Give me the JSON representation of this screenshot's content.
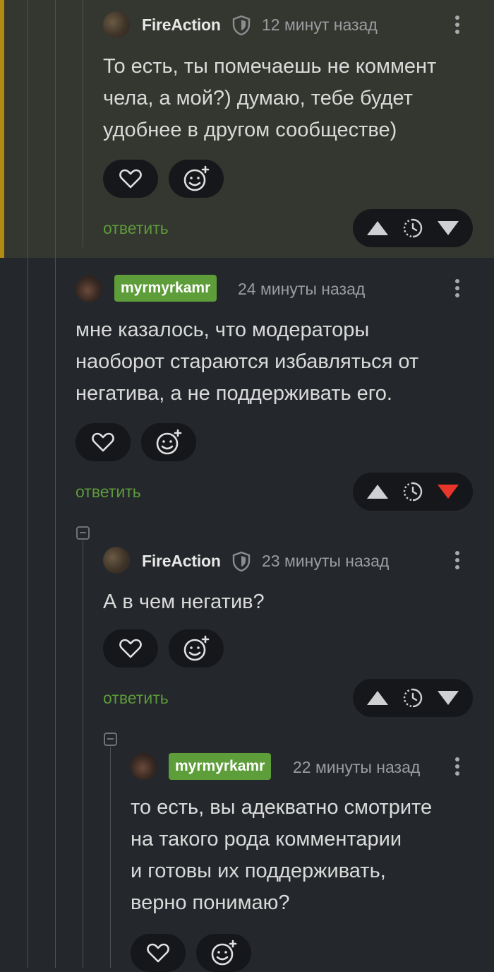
{
  "colors": {
    "accent_green": "#5e9e3a",
    "downvote_red": "#e8362a",
    "highlight_bar": "#b08a12"
  },
  "comments": [
    {
      "author": "FireAction",
      "time": "12 минут назад",
      "lines": [
        "То есть, ты помечаешь не коммент",
        "чела, а мой?) думаю, тебе будет",
        "удобнее в другом сообществе)"
      ],
      "reply_label": "ответить"
    },
    {
      "author": "myrmyrkamr",
      "time": "24 минуты назад",
      "lines": [
        "мне казалось, что модераторы",
        "наоборот стараются избавляться от",
        "негатива, а не поддерживать его."
      ],
      "reply_label": "ответить",
      "downvoted": true
    },
    {
      "author": "FireAction",
      "time": "23 минуты назад",
      "lines": [
        "А в чем негатив?"
      ],
      "reply_label": "ответить"
    },
    {
      "author": "myrmyrkamr",
      "time": "22 минуты назад",
      "lines": [
        "то есть, вы адекватно смотрите",
        "на такого рода комментарии",
        "и готовы их поддерживать,",
        "верно понимаю?"
      ]
    }
  ]
}
